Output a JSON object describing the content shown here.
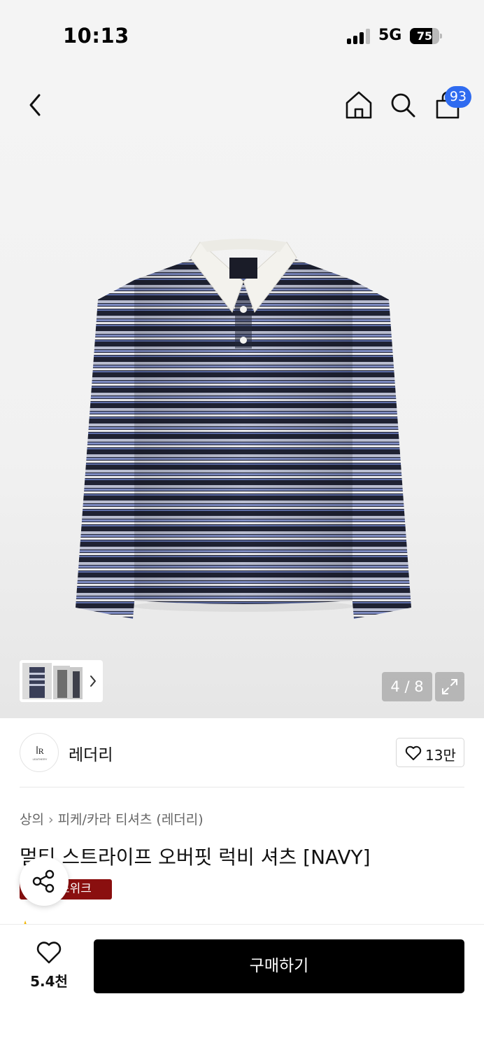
{
  "status_bar": {
    "time": "10:13",
    "network": "5G",
    "battery_percent": "75",
    "battery_level": 0.75
  },
  "header": {
    "cart_count": "93"
  },
  "gallery": {
    "current": 4,
    "total": 8,
    "pager_text": "4 / 8"
  },
  "brand": {
    "name": "레더리",
    "logo_text": "LEATHERY",
    "likes": "13만"
  },
  "product": {
    "breadcrumb": [
      "상의",
      "피케/카라 티셔츠 (레더리)"
    ],
    "title": "멀티 스트라이프 오버핏 럭비 셔츠 [NAVY]",
    "promo_badge": "스위크"
  },
  "bottom_bar": {
    "wish_count": "5.4천",
    "buy_label": "구매하기"
  },
  "colors": {
    "accent_blue": "#2f6bf0",
    "promo_red": "#8a0f0f",
    "buy_black": "#000000"
  }
}
